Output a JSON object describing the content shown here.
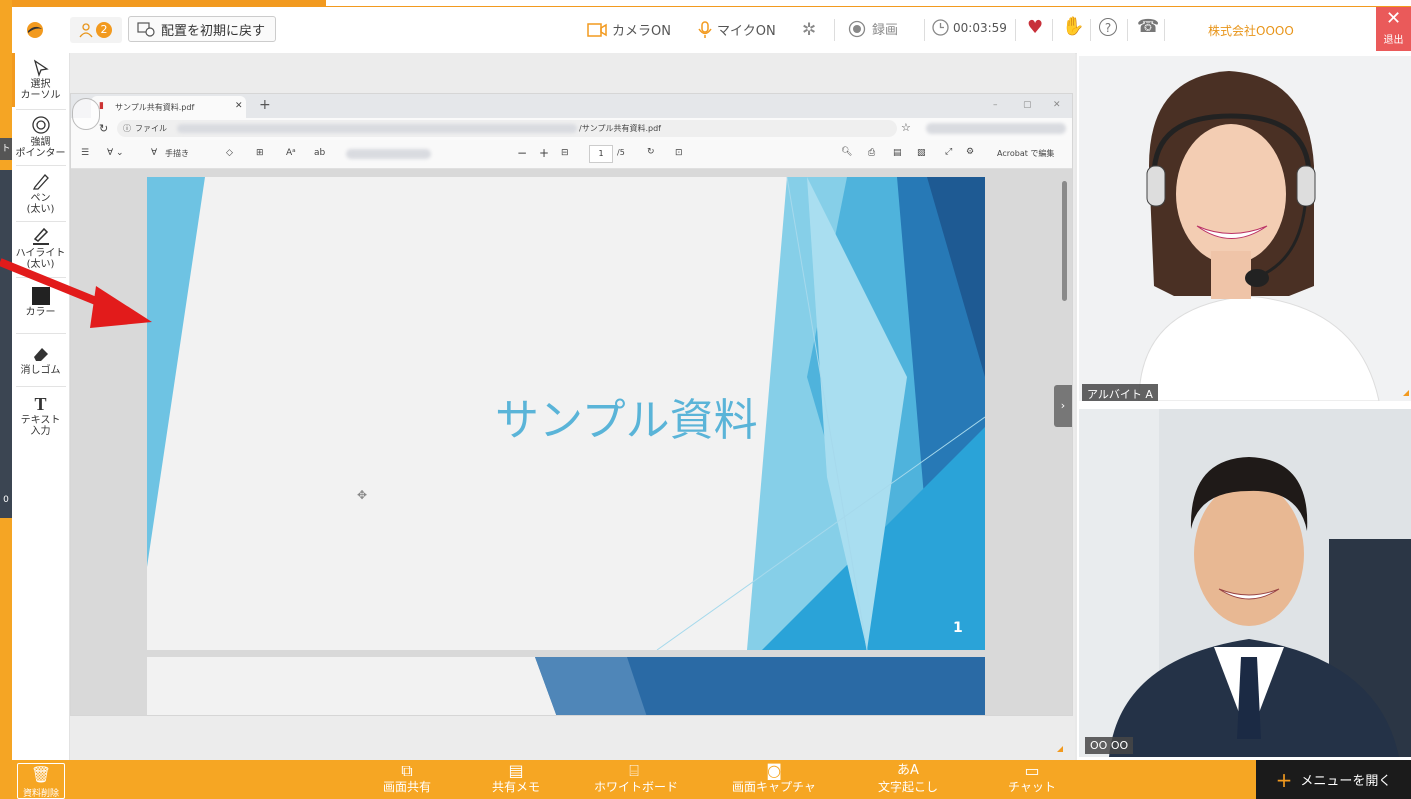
{
  "topbar": {
    "participants_count": "2",
    "reset_label": "配置を初期に戻す",
    "camera_label": "カメラON",
    "mic_label": "マイクON",
    "record_label": "録画",
    "timer": "00:03:59",
    "company": "株式会社OOOO",
    "exit_label": "退出",
    "accent_color": "#f29a1f"
  },
  "tools": [
    {
      "label1": "選択",
      "label2": "カーソル"
    },
    {
      "label1": "強調",
      "label2": "ポインター"
    },
    {
      "label1": "ペン",
      "label2": "(太い)"
    },
    {
      "label1": "ハイライト",
      "label2": "(太い)"
    },
    {
      "label1": "カラー",
      "label2": ""
    },
    {
      "label1": "消しゴム",
      "label2": ""
    },
    {
      "label1": "テキスト",
      "label2": "入力"
    }
  ],
  "left_edge": {
    "tab_label": "ト",
    "small_num": "0"
  },
  "pdf": {
    "tab_title": "サンプル共有資料.pdf",
    "url_prefix": "ファイル",
    "url_suffix": "/サンプル共有資料.pdf",
    "draw_label": "手描き",
    "page_current": "1",
    "page_total": "/5",
    "acrobat_label": "Acrobat で編集",
    "slide_title": "サンプル資料",
    "slide_number": "1"
  },
  "video": [
    {
      "name": "アルバイト A"
    },
    {
      "name": "OO OO"
    }
  ],
  "bottombar": {
    "trash_label": "資料削除",
    "items": [
      "画面共有",
      "共有メモ",
      "ホワイトボード",
      "画面キャプチャ",
      "文字起こし",
      "チャット"
    ],
    "menu_label": "メニューを開く"
  }
}
